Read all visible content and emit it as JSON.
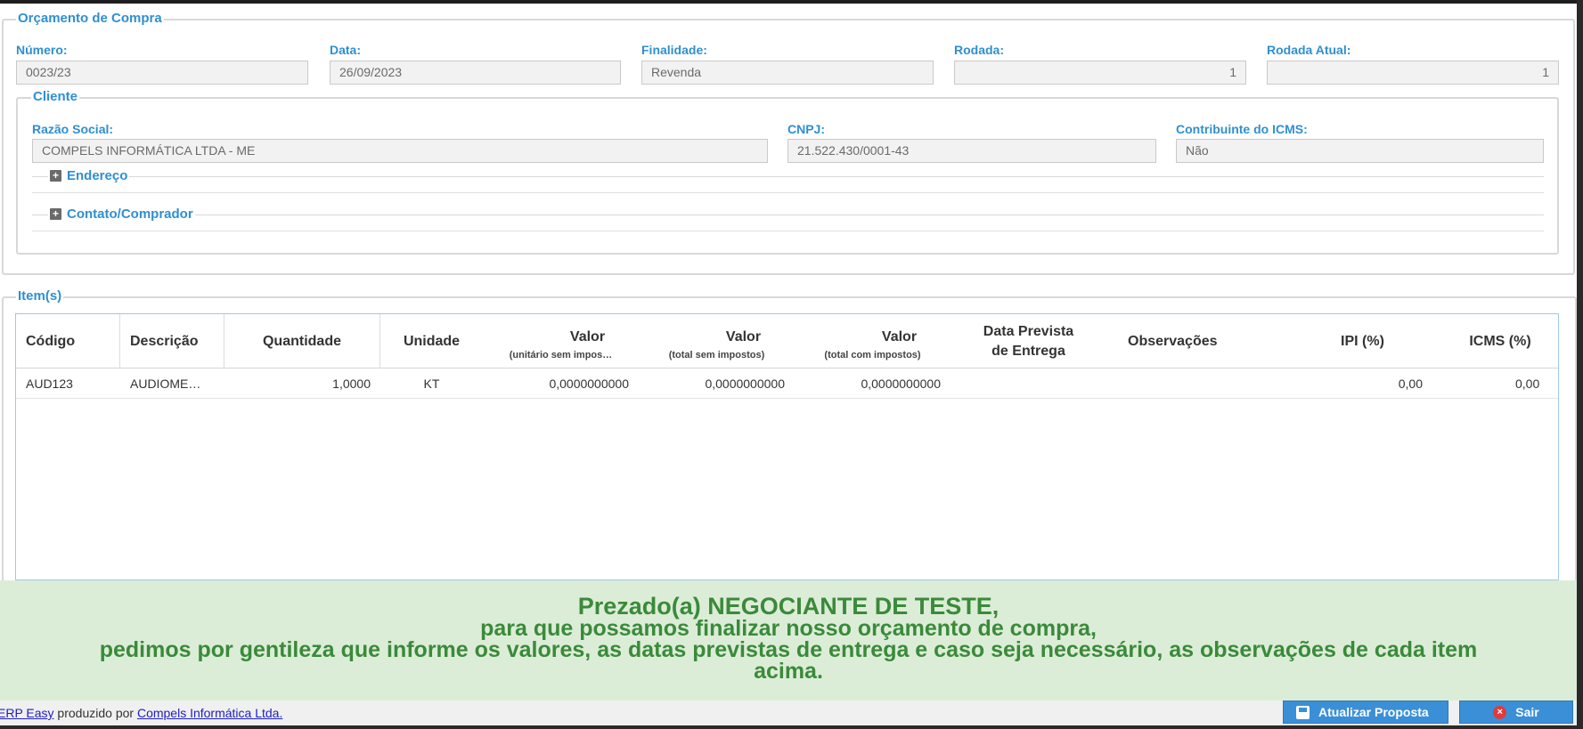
{
  "orcamento": {
    "legend": "Orçamento de Compra",
    "numero": {
      "label": "Número:",
      "value": "0023/23"
    },
    "data": {
      "label": "Data:",
      "value": "26/09/2023"
    },
    "finalidade": {
      "label": "Finalidade:",
      "value": "Revenda"
    },
    "rodada": {
      "label": "Rodada:",
      "value": "1"
    },
    "rodada_atual": {
      "label": "Rodada Atual:",
      "value": "1"
    }
  },
  "cliente": {
    "legend": "Cliente",
    "razao_social": {
      "label": "Razão Social:",
      "value": "COMPELS INFORMÁTICA LTDA - ME"
    },
    "cnpj": {
      "label": "CNPJ:",
      "value": "21.522.430/0001-43"
    },
    "icms": {
      "label": "Contribuinte do ICMS:",
      "value": "Não"
    },
    "endereco_label": "Endereço",
    "contato_label": "Contato/Comprador"
  },
  "itens": {
    "legend": "Item(s)",
    "columns": {
      "codigo": "Código",
      "descricao": "Descrição",
      "quantidade": "Quantidade",
      "unidade": "Unidade",
      "valor_unit": "Valor",
      "valor_unit_sub": "(unitário sem impos…",
      "valor_total": "Valor",
      "valor_total_sub": "(total sem impostos)",
      "valor_total_imp": "Valor",
      "valor_total_imp_sub": "(total com impostos)",
      "data_prev_1": "Data Prevista",
      "data_prev_2": "de Entrega",
      "observacoes": "Observações",
      "ipi": "IPI (%)",
      "icms": "ICMS (%)"
    },
    "rows": [
      {
        "codigo": "AUD123",
        "descricao": "AUDIOME…",
        "quantidade": "1,0000",
        "unidade": "KT",
        "valor_unit": "0,0000000000",
        "valor_total": "0,0000000000",
        "valor_total_imp": "0,0000000000",
        "data_prev": "",
        "observacoes": "",
        "ipi": "0,00",
        "icms": "0,00"
      }
    ]
  },
  "banner": {
    "line1": "Prezado(a) NEGOCIANTE DE TESTE,",
    "line2": "para que possamos finalizar nosso orçamento de compra,",
    "line3": "pedimos por gentileza que informe os valores, as datas previstas de entrega e caso seja necessário, as observações de cada item",
    "line4": "acima."
  },
  "footer": {
    "erp_link": "ERP Easy",
    "produced_by": " produzido por ",
    "company_link": "Compels Informática Ltda.",
    "update_button": "Atualizar Proposta",
    "exit_button": "Sair"
  },
  "colors": {
    "accent": "#2f8fd0",
    "banner_bg": "#dcedd7",
    "banner_text": "#3a8a3a",
    "button": "#3b8fd6"
  }
}
